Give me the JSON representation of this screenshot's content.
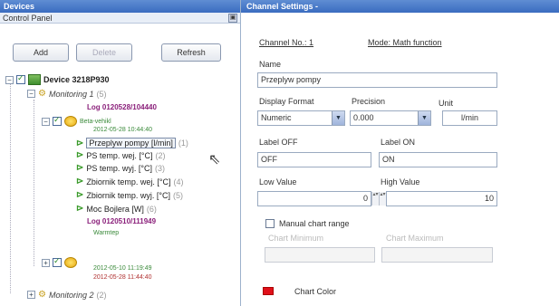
{
  "left": {
    "title": "Devices",
    "subtitle": "Control Panel",
    "buttons": {
      "add": "Add",
      "delete": "Delete",
      "refresh": "Refresh"
    },
    "tree": {
      "device": "Device 3218P930",
      "monitoring1": "Monitoring 1",
      "monitoring1_count": "(5)",
      "log1_title": "Log 0120528/104440",
      "log1_sub": "Beta-vehikl",
      "log1_date": "2012-05-28 10:44:40",
      "channels": [
        {
          "label": "Przeplyw pompy [l/min]",
          "count": "(1)"
        },
        {
          "label": "PS temp. wej. [°C]",
          "count": "(2)"
        },
        {
          "label": "PS temp. wyj. [°C]",
          "count": "(3)"
        },
        {
          "label": "Zbiornik temp. wej. [°C]",
          "count": "(4)"
        },
        {
          "label": "Zbiornik temp. wyj. [°C]",
          "count": "(5)"
        },
        {
          "label": "Moc Bojlera [W]",
          "count": "(6)"
        }
      ],
      "log2_title": "Log 0120510/111949",
      "log2_sub": "Warmtep",
      "log2_date1": "2012-05-10 11:19:49",
      "log2_date2": "2012-05-28 11:44:40",
      "monitoring2": "Monitoring 2",
      "monitoring2_count": "(2)"
    }
  },
  "right": {
    "title": "Channel Settings -",
    "channel_no_label": "Channel No.: 1",
    "mode_label": "Mode: Math function",
    "name_label": "Name",
    "name_value": "Przeplyw pompy",
    "display_format_label": "Display Format",
    "display_format_value": "Numeric",
    "precision_label": "Precision",
    "precision_value": "0.000",
    "unit_label": "Unit",
    "unit_value": "l/min",
    "label_off_label": "Label OFF",
    "label_off_value": "OFF",
    "label_on_label": "Label ON",
    "label_on_value": "ON",
    "low_value_label": "Low Value",
    "low_value": "0",
    "high_value_label": "High Value",
    "high_value": "10",
    "manual_chart_range_label": "Manual chart range",
    "chart_minimum_label": "Chart Minimum",
    "chart_maximum_label": "Chart Maximum",
    "chart_color_label": "Chart Color",
    "chart_color": "#e0101a"
  }
}
